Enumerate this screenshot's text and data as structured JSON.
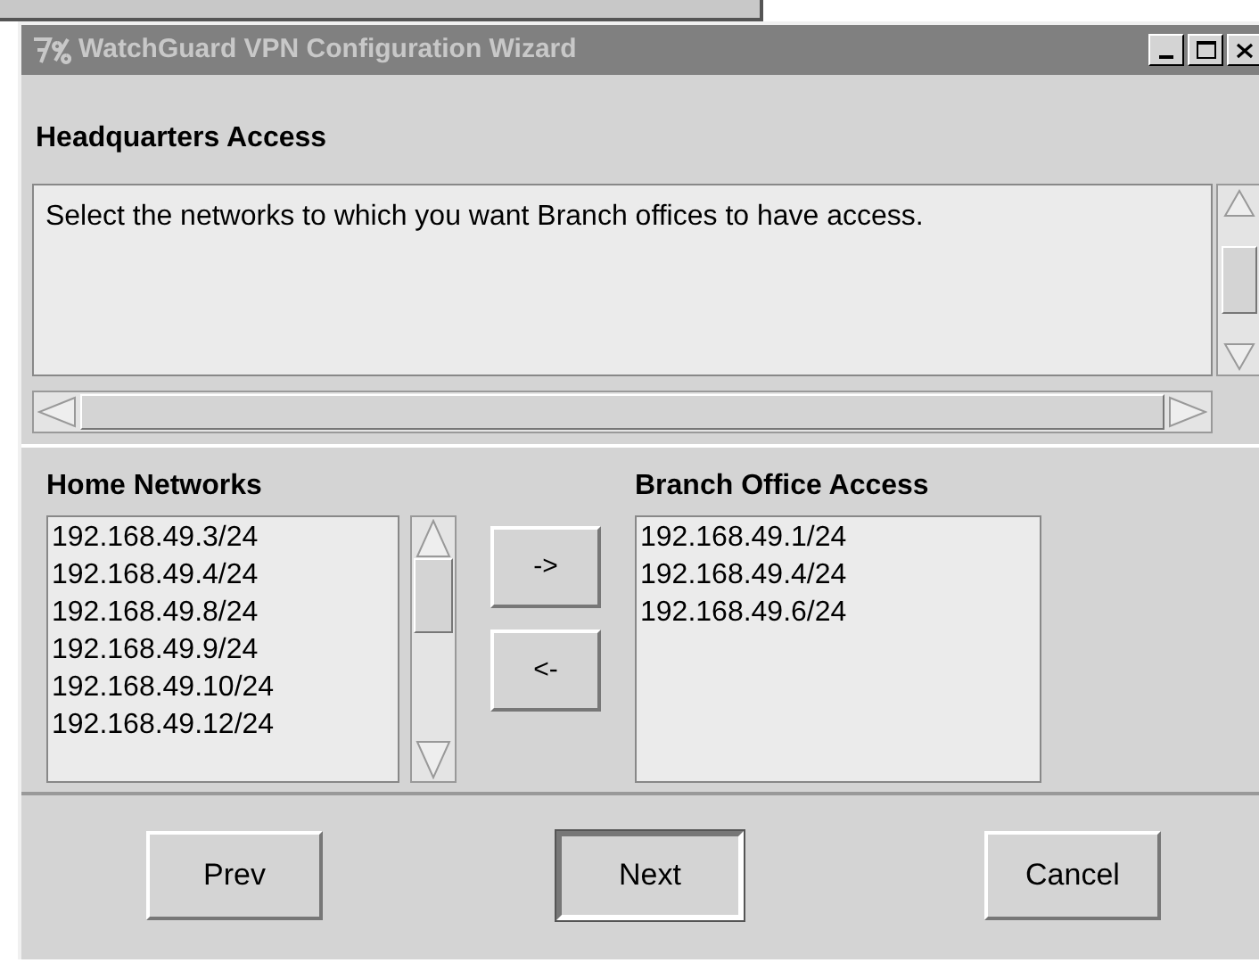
{
  "window": {
    "title": "WatchGuard VPN Configuration Wizard"
  },
  "heading": "Headquarters Access",
  "description": " Select the networks to which you want Branch offices to have access.",
  "home_networks": {
    "label": "Home Networks",
    "items": [
      "192.168.49.3/24",
      "192.168.49.4/24",
      "192.168.49.8/24",
      "192.168.49.9/24",
      "192.168.49.10/24",
      "192.168.49.12/24"
    ]
  },
  "move_buttons": [
    "->",
    "<-"
  ],
  "branch_office_access": {
    "label": "Branch Office Access",
    "items": [
      "192.168.49.1/24",
      "192.168.49.4/24",
      "192.168.49.6/24"
    ]
  },
  "buttons": [
    {
      "label": "Prev",
      "default": false
    },
    {
      "label": "Next",
      "default": true
    },
    {
      "label": "Cancel",
      "default": false
    }
  ]
}
